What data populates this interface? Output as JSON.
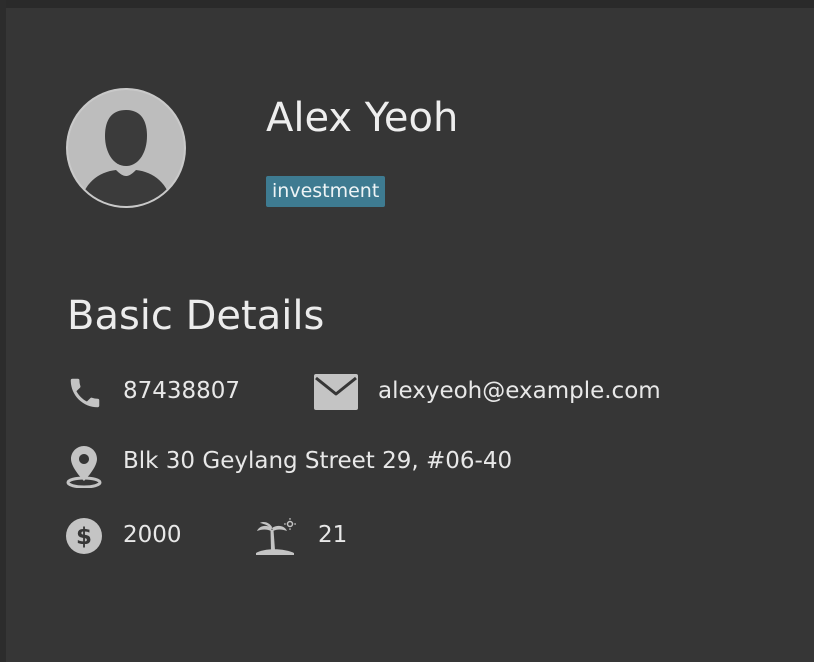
{
  "person": {
    "name": "Alex Yeoh",
    "tags": [
      "investment"
    ]
  },
  "section": {
    "title": "Basic Details"
  },
  "details": {
    "phone": "87438807",
    "email": "alexyeoh@example.com",
    "address": "Blk 30 Geylang Street 29, #06-40",
    "salary": "2000",
    "leave": "21"
  },
  "icons": {
    "avatar": "user-avatar-icon",
    "phone": "phone-icon",
    "email": "envelope-icon",
    "address": "map-pin-icon",
    "salary": "dollar-icon",
    "leave": "palm-tree-icon"
  },
  "colors": {
    "background": "#363636",
    "tag": "#3e7b91",
    "icon": "#c4c4c4",
    "text": "#ececec"
  }
}
